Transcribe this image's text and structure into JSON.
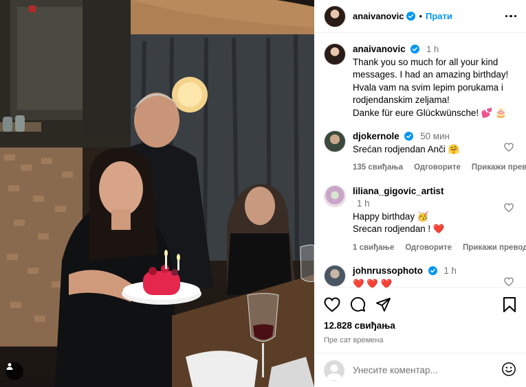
{
  "post": {
    "author": "anaivanovic",
    "follow_label": "Прати",
    "dot": "•",
    "caption_time": "1 h",
    "caption_text": "Thank you so much for all your kind messages. I had an amazing birthday! Hvala vam na svim lepim porukama i rodjendanskim zeljama!\nDanke für eure Glückwünsche! 💕 🎂"
  },
  "comments": [
    {
      "username": "djokernole",
      "verified": true,
      "time": "50 мин",
      "text": "Srećan rodjendan Anči 🤗",
      "likes": "135 свиђања",
      "reply": "Одговорите",
      "translate": "Прикажи превод"
    },
    {
      "username": "liliana_gigovic_artist",
      "verified": false,
      "time": "1 h",
      "text": "Happy birthday 🥳 Srecan rodjendan ! ❤️",
      "likes": "1 свиђање",
      "reply": "Одговорите",
      "translate": "Прикажи превод"
    },
    {
      "username": "johnrussophoto",
      "verified": true,
      "time": "1 h",
      "text": "❤️ ❤️ ❤️",
      "likes": "",
      "reply": "",
      "translate": ""
    }
  ],
  "footer": {
    "likes_count": "12.828 свиђања",
    "posted_ago": "Пре сат времена",
    "comment_placeholder": "Унесите коментар..."
  },
  "icons": {
    "like": "heart-icon",
    "comment": "comment-icon",
    "share": "share-icon",
    "save": "bookmark-icon",
    "emoji": "emoji-icon",
    "more": "more-icon",
    "tag": "user-tag-icon",
    "verified": "verified-badge-icon"
  },
  "colors": {
    "link_blue": "#0095f6",
    "verified_blue": "#0095f6",
    "muted_text": "#737373",
    "heart_red": "#e0245e"
  }
}
